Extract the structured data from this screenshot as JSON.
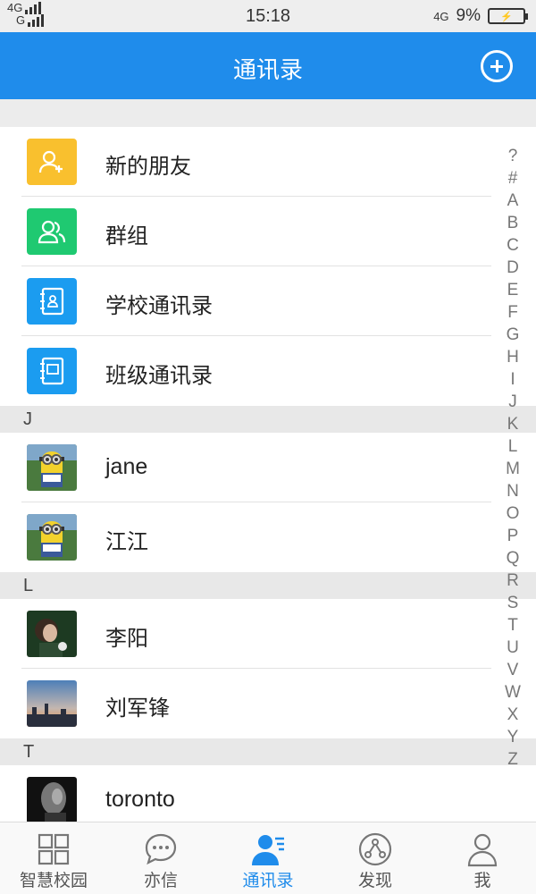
{
  "status_bar": {
    "net_top": "4G",
    "net_bottom": "G",
    "time": "15:18",
    "net_right": "4G",
    "battery_pct": "9%"
  },
  "header": {
    "title": "通讯录"
  },
  "menu_items": [
    {
      "label": "新的朋友",
      "icon": "new-friend-icon",
      "color": "#f9c02e"
    },
    {
      "label": "群组",
      "icon": "group-icon",
      "color": "#1fc971"
    },
    {
      "label": "学校通讯录",
      "icon": "school-contacts-icon",
      "color": "#1b9cf0"
    },
    {
      "label": "班级通讯录",
      "icon": "class-contacts-icon",
      "color": "#1b9cf0"
    }
  ],
  "sections": [
    {
      "letter": "J",
      "contacts": [
        {
          "name": "jane"
        },
        {
          "name": "江江"
        }
      ]
    },
    {
      "letter": "L",
      "contacts": [
        {
          "name": "李阳"
        },
        {
          "name": "刘军锋"
        }
      ]
    },
    {
      "letter": "T",
      "contacts": [
        {
          "name": "toronto"
        }
      ]
    }
  ],
  "alphabet": [
    "?",
    "#",
    "A",
    "B",
    "C",
    "D",
    "E",
    "F",
    "G",
    "H",
    "I",
    "J",
    "K",
    "L",
    "M",
    "N",
    "O",
    "P",
    "Q",
    "R",
    "S",
    "T",
    "U",
    "V",
    "W",
    "X",
    "Y",
    "Z"
  ],
  "tabs": [
    {
      "label": "智慧校园",
      "icon": "grid-icon"
    },
    {
      "label": "亦信",
      "icon": "chat-bubble-icon"
    },
    {
      "label": "通讯录",
      "icon": "contacts-icon",
      "active": true
    },
    {
      "label": "发现",
      "icon": "discover-icon"
    },
    {
      "label": "我",
      "icon": "profile-icon"
    }
  ],
  "colors": {
    "accent": "#1f8ceb"
  }
}
